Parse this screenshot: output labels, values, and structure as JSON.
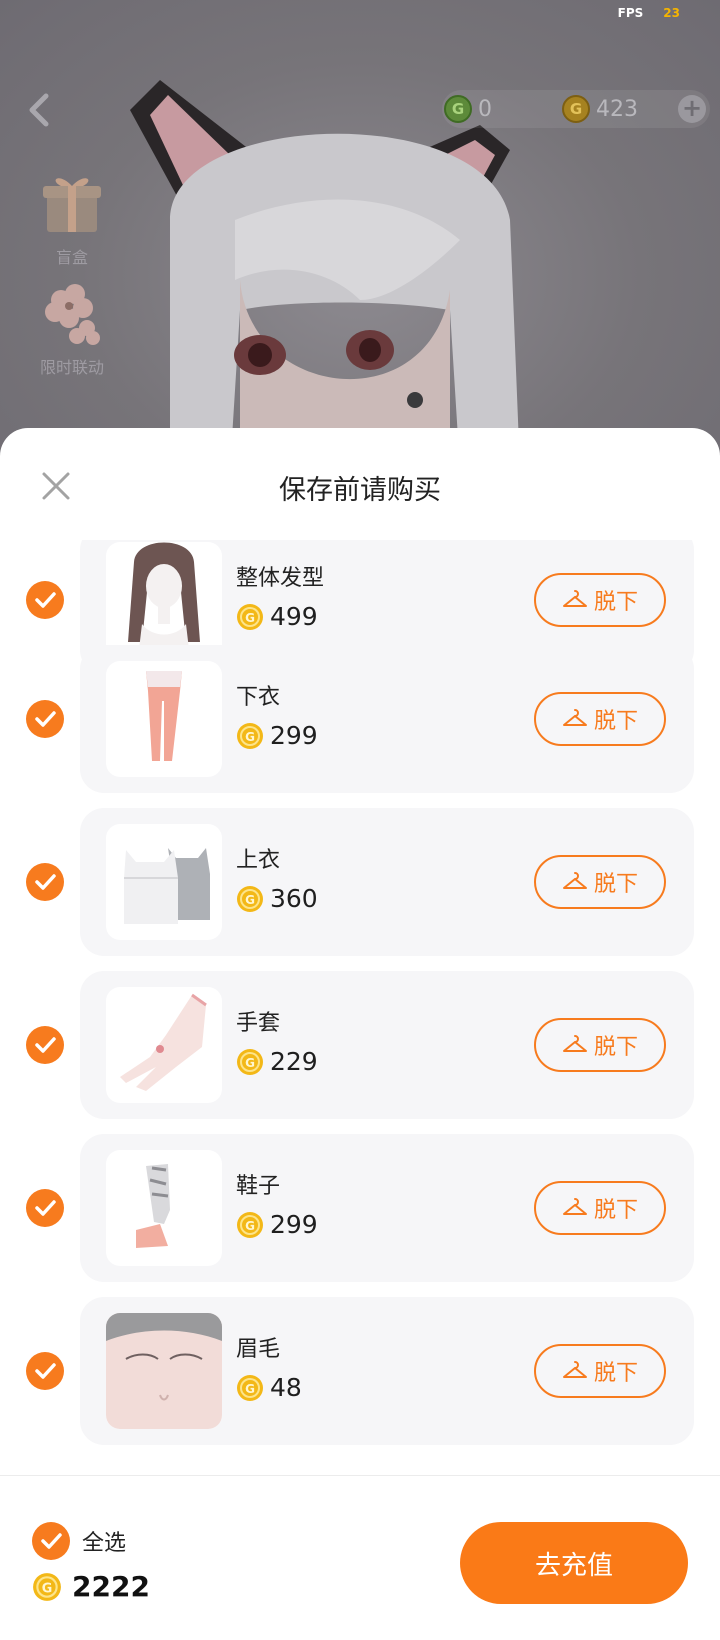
{
  "status": {
    "fps_label": "FPS",
    "fps_value": "23"
  },
  "topbar": {
    "green_balance": "0",
    "gold_balance": "423",
    "plus_label": "+"
  },
  "side_menu": [
    {
      "label": "盲盒",
      "icon": "gift-box-icon"
    },
    {
      "label": "限时联动",
      "icon": "flower-icon"
    }
  ],
  "sheet": {
    "title": "保存前请购买",
    "items": [
      {
        "name": "整体发型",
        "price": "499",
        "action": "脱下",
        "checked": true,
        "thumb": "hairstyle"
      },
      {
        "name": "下衣",
        "price": "299",
        "action": "脱下",
        "checked": true,
        "thumb": "leggings"
      },
      {
        "name": "上衣",
        "price": "360",
        "action": "脱下",
        "checked": true,
        "thumb": "camisole"
      },
      {
        "name": "手套",
        "price": "229",
        "action": "脱下",
        "checked": true,
        "thumb": "glove"
      },
      {
        "name": "鞋子",
        "price": "299",
        "action": "脱下",
        "checked": true,
        "thumb": "shoes"
      },
      {
        "name": "眉毛",
        "price": "48",
        "action": "脱下",
        "checked": true,
        "thumb": "eyebrows"
      }
    ]
  },
  "footer": {
    "select_all_label": "全选",
    "total": "2222",
    "recharge_label": "去充值"
  },
  "colors": {
    "accent": "#f77b1e",
    "button": "#fa7a17",
    "coin_gold": "#f3b817"
  }
}
